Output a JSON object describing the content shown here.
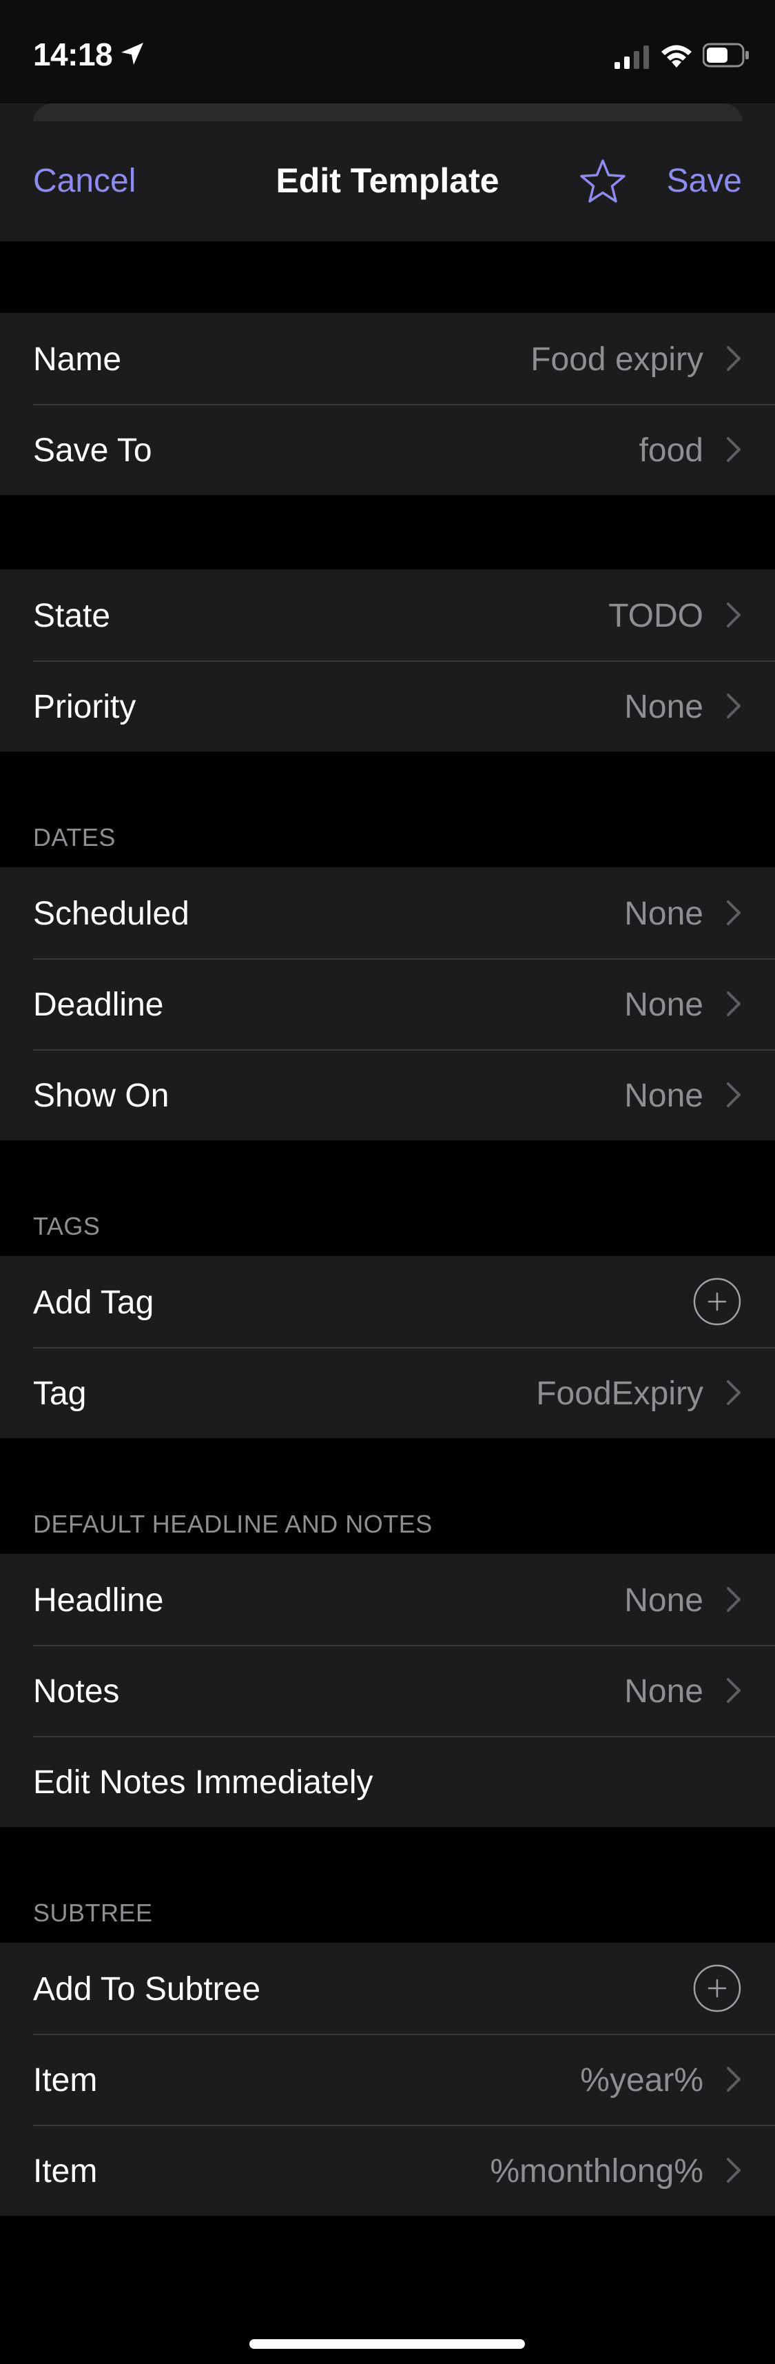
{
  "status_bar": {
    "time": "14:18",
    "icons": [
      "location-arrow-icon",
      "cellular-signal-icon",
      "wifi-icon",
      "battery-icon"
    ]
  },
  "nav": {
    "cancel_label": "Cancel",
    "title": "Edit Template",
    "favorite_icon": "star-icon",
    "save_label": "Save",
    "accent_color": "#8e8cf0"
  },
  "general": {
    "rows": [
      {
        "label": "Name",
        "value": "Food expiry"
      },
      {
        "label": "Save To",
        "value": "food"
      }
    ]
  },
  "state": {
    "rows": [
      {
        "label": "State",
        "value": "TODO"
      },
      {
        "label": "Priority",
        "value": "None"
      }
    ]
  },
  "dates": {
    "header": "DATES",
    "rows": [
      {
        "label": "Scheduled",
        "value": "None"
      },
      {
        "label": "Deadline",
        "value": "None"
      },
      {
        "label": "Show On",
        "value": "None"
      }
    ]
  },
  "tags": {
    "header": "TAGS",
    "add_label": "Add Tag",
    "rows": [
      {
        "label": "Tag",
        "value": "FoodExpiry"
      }
    ]
  },
  "headline_notes": {
    "header": "DEFAULT HEADLINE AND NOTES",
    "rows": [
      {
        "label": "Headline",
        "value": "None"
      },
      {
        "label": "Notes",
        "value": "None"
      }
    ],
    "edit_notes_label": "Edit Notes Immediately"
  },
  "subtree": {
    "header": "SUBTREE",
    "add_label": "Add To Subtree",
    "rows": [
      {
        "label": "Item",
        "value": "%year%"
      },
      {
        "label": "Item",
        "value": "%monthlong%"
      }
    ]
  }
}
